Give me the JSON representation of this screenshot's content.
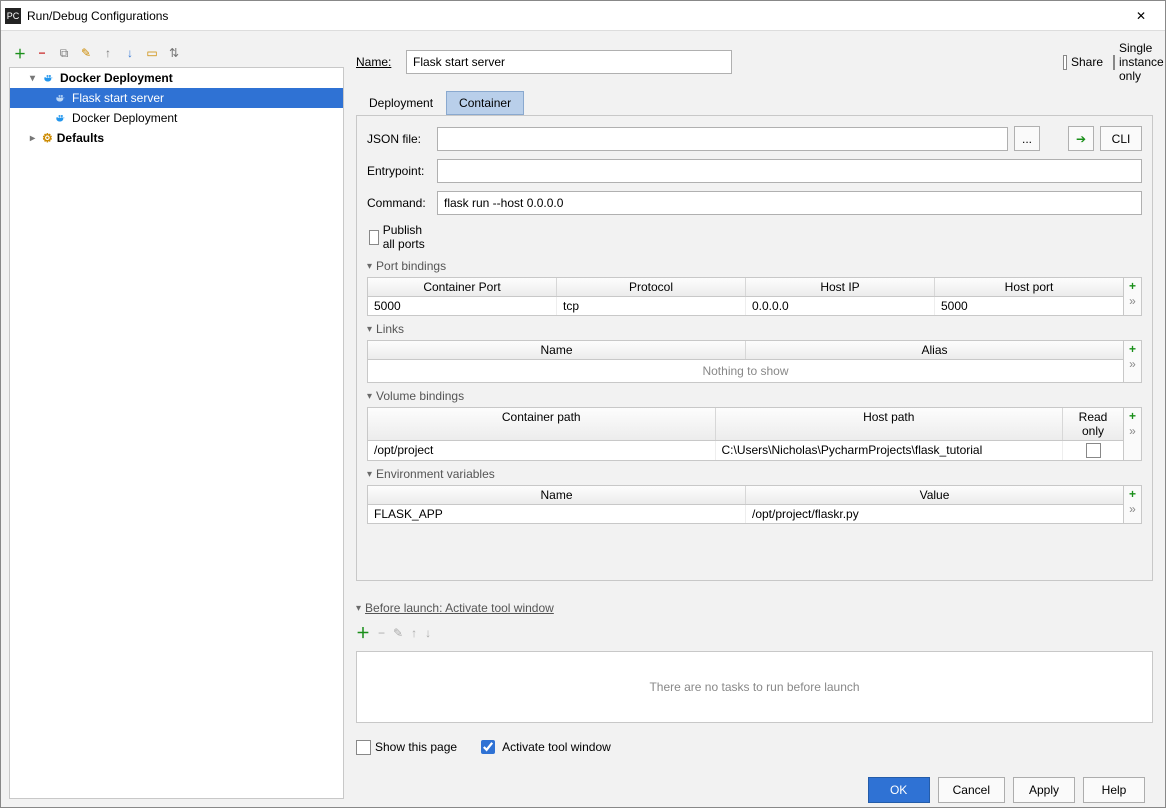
{
  "window": {
    "title": "Run/Debug Configurations"
  },
  "share_label": "Share",
  "single_instance_label": "Single instance only",
  "name_label": "Name:",
  "name_value": "Flask start server",
  "tree": {
    "root": "Docker Deployment",
    "children": [
      "Flask start server",
      "Docker Deployment"
    ],
    "defaults": "Defaults"
  },
  "tabs": {
    "deployment": "Deployment",
    "container": "Container"
  },
  "form": {
    "json_label": "JSON file:",
    "json_value": "",
    "entry_label": "Entrypoint:",
    "entry_value": "",
    "cmd_label": "Command:",
    "cmd_value": "flask run --host 0.0.0.0",
    "publish_label": "Publish all ports",
    "cli_label": "CLI",
    "ellipsis": "..."
  },
  "port": {
    "title": "Port bindings",
    "h1": "Container Port",
    "h2": "Protocol",
    "h3": "Host IP",
    "h4": "Host port",
    "r1c1": "5000",
    "r1c2": "tcp",
    "r1c3": "0.0.0.0",
    "r1c4": "5000"
  },
  "links": {
    "title": "Links",
    "h1": "Name",
    "h2": "Alias",
    "empty": "Nothing to show"
  },
  "vol": {
    "title": "Volume bindings",
    "h1": "Container path",
    "h2": "Host path",
    "h3": "Read only",
    "r1c1": "/opt/project",
    "r1c2": "C:\\Users\\Nicholas\\PycharmProjects\\flask_tutorial"
  },
  "env": {
    "title": "Environment variables",
    "h1": "Name",
    "h2": "Value",
    "r1c1": "FLASK_APP",
    "r1c2": "/opt/project/flaskr.py"
  },
  "before": {
    "title": "Before launch: Activate tool window",
    "empty": "There are no tasks to run before launch",
    "show_page": "Show this page",
    "activate": "Activate tool window"
  },
  "buttons": {
    "ok": "OK",
    "cancel": "Cancel",
    "apply": "Apply",
    "help": "Help"
  }
}
